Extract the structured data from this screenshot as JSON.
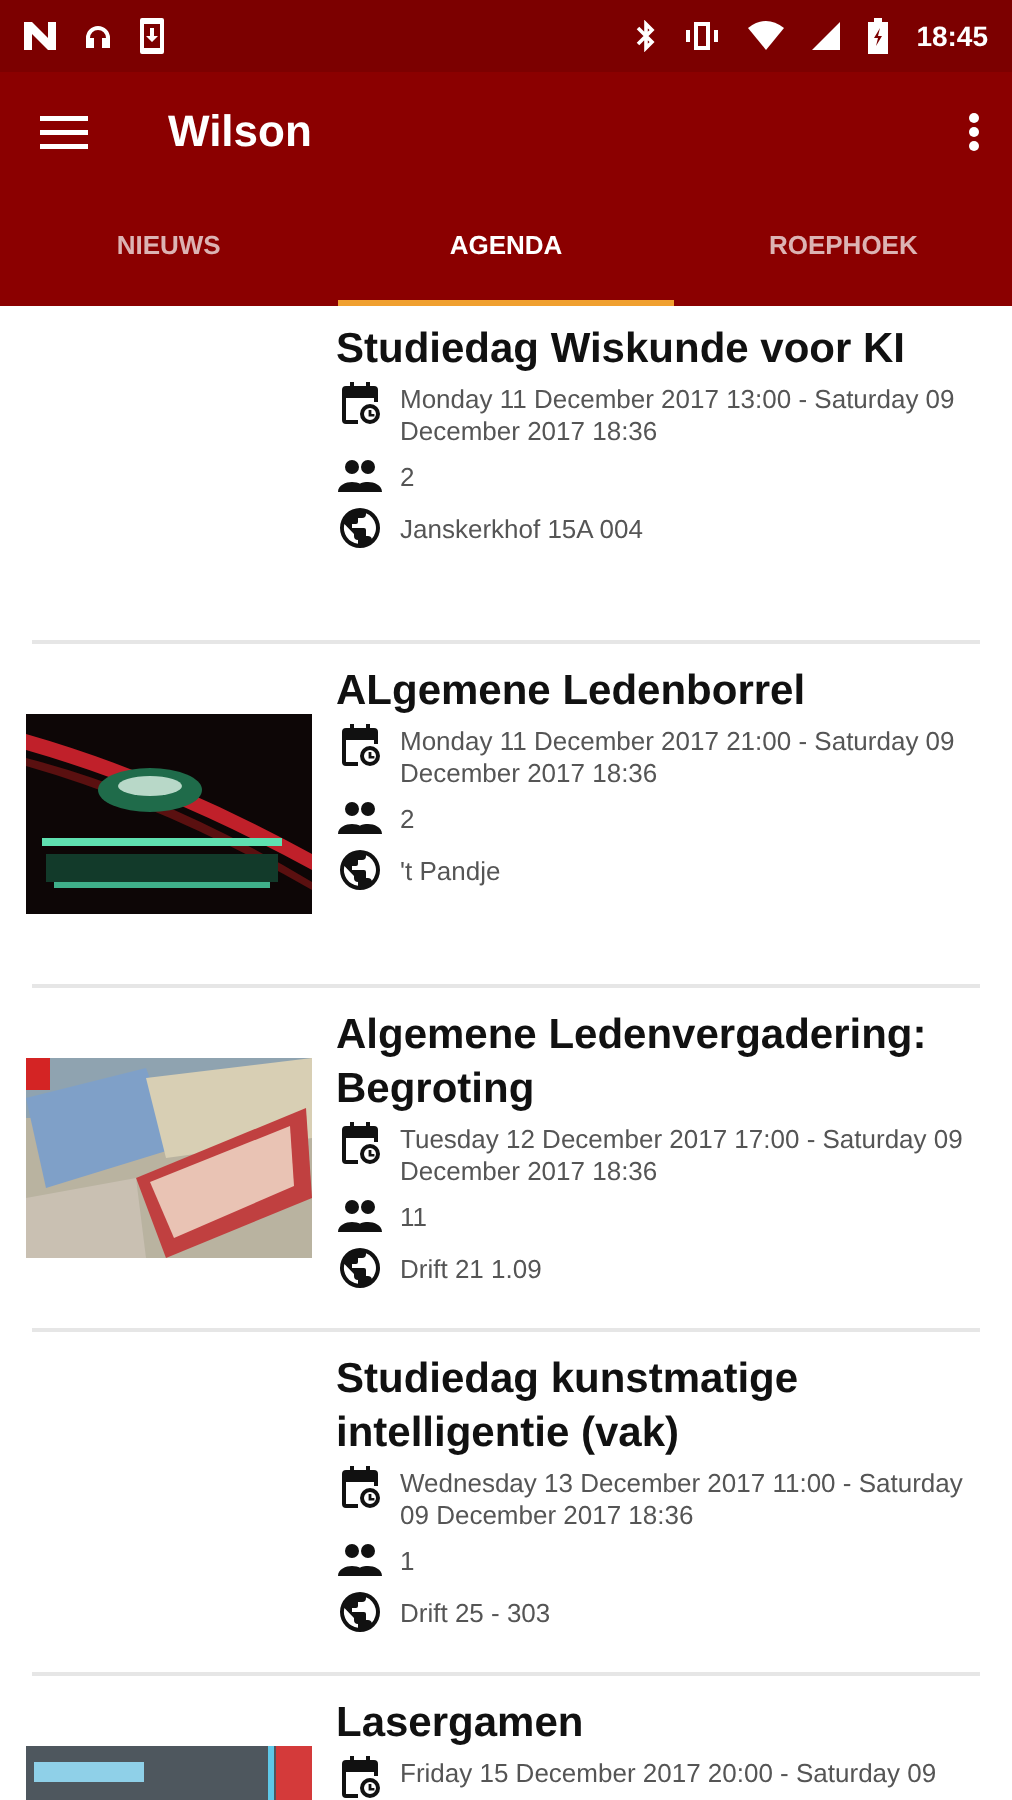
{
  "status_bar": {
    "time": "18:45"
  },
  "app_bar": {
    "title": "Wilson"
  },
  "tabs": [
    {
      "label": "NIEUWS",
      "selected": false
    },
    {
      "label": "AGENDA",
      "selected": true
    },
    {
      "label": "ROEPHOEK",
      "selected": false
    }
  ],
  "events": [
    {
      "kind": "text",
      "title": "Studiedag Wiskunde voor KI",
      "date": "Monday 11 December 2017 13:00 - Saturday 09 December 2017 18:36",
      "attendees": "2",
      "location": "Janskerkhof 15A 004"
    },
    {
      "kind": "picture",
      "title": "ALgemene Ledenborrel",
      "date": "Monday 11 December 2017 21:00 - Saturday 09 December 2017 18:36",
      "attendees": "2",
      "location": "'t Pandje"
    },
    {
      "kind": "picture",
      "title": "Algemene Ledenvergadering: Begroting",
      "date": "Tuesday 12 December 2017 17:00 - Saturday 09 December 2017 18:36",
      "attendees": "11",
      "location": "Drift 21 1.09"
    },
    {
      "kind": "text",
      "title": "Studiedag kunstmatige intelligentie (vak)",
      "date": "Wednesday 13 December 2017 11:00 - Saturday 09 December 2017 18:36",
      "attendees": "1",
      "location": "Drift 25 - 303"
    },
    {
      "kind": "picture",
      "title": "Lasergamen",
      "date": "Friday 15 December 2017 20:00 - Saturday 09"
    }
  ]
}
